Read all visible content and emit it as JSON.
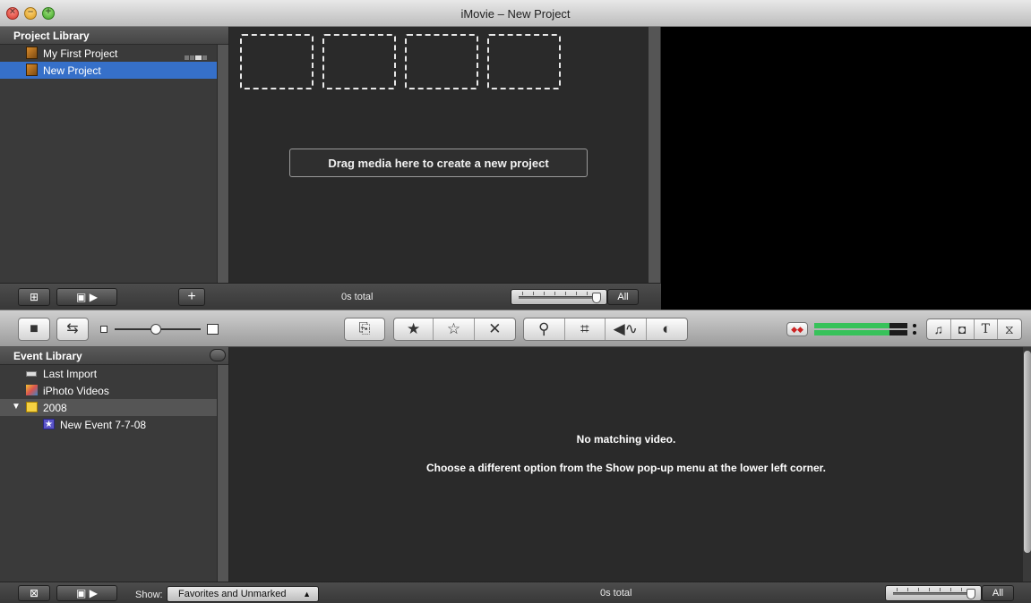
{
  "window": {
    "title": "iMovie – New Project"
  },
  "project_library": {
    "header": "Project Library",
    "items": [
      {
        "label": "My First Project",
        "selected": false
      },
      {
        "label": "New Project",
        "selected": true
      }
    ]
  },
  "project_browser": {
    "drop_hint": "Drag media here to create a new project",
    "total": "0s total",
    "zoom_all_label": "All"
  },
  "event_library": {
    "header": "Event Library",
    "items": [
      {
        "label": "Last Import",
        "icon": "last-import-icon"
      },
      {
        "label": "iPhoto Videos",
        "icon": "iphoto-icon"
      },
      {
        "label": "2008",
        "icon": "calendar-icon",
        "expanded": true
      },
      {
        "label": "New Event 7-7-08",
        "icon": "event-star-icon"
      }
    ]
  },
  "event_browser": {
    "message_title": "No matching video.",
    "message_body": "Choose a different option from the Show pop-up menu at the lower left corner.",
    "show_label": "Show:",
    "show_value": "Favorites and Unmarked",
    "total": "0s total",
    "zoom_all_label": "All"
  },
  "colors": {
    "selection": "#3670c9",
    "meter_green": "#37c25a"
  }
}
